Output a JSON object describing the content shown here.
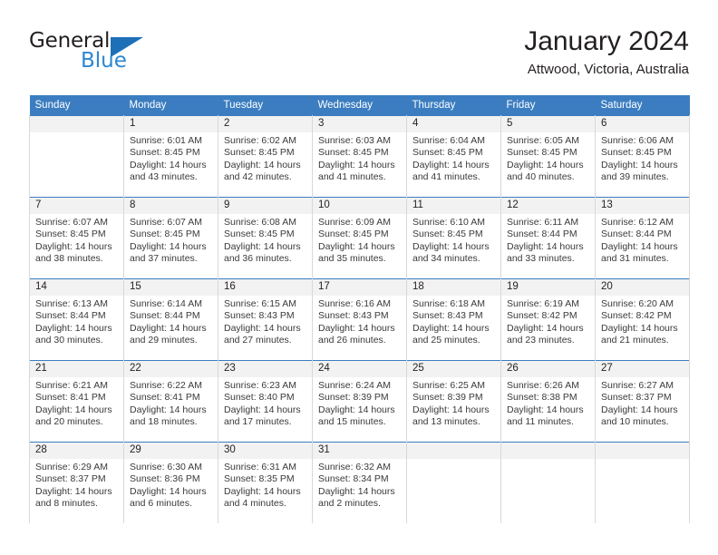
{
  "brand": {
    "name_part1": "General",
    "name_part2": "Blue",
    "triangle_color": "#1d70b8",
    "blue_color": "#2b87d3"
  },
  "header": {
    "title": "January 2024",
    "location": "Attwood, Victoria, Australia"
  },
  "theme": {
    "header_bar_color": "#3b7dc0",
    "daynum_band_color": "#f2f2f2",
    "cell_border_color": "#d8d8d8",
    "text_color": "#231f20"
  },
  "weekdays": [
    "Sunday",
    "Monday",
    "Tuesday",
    "Wednesday",
    "Thursday",
    "Friday",
    "Saturday"
  ],
  "weeks": [
    [
      {
        "day": "",
        "sunrise": "",
        "sunset": "",
        "daylight_line1": "",
        "daylight_line2": ""
      },
      {
        "day": "1",
        "sunrise": "Sunrise: 6:01 AM",
        "sunset": "Sunset: 8:45 PM",
        "daylight_line1": "Daylight: 14 hours",
        "daylight_line2": "and 43 minutes."
      },
      {
        "day": "2",
        "sunrise": "Sunrise: 6:02 AM",
        "sunset": "Sunset: 8:45 PM",
        "daylight_line1": "Daylight: 14 hours",
        "daylight_line2": "and 42 minutes."
      },
      {
        "day": "3",
        "sunrise": "Sunrise: 6:03 AM",
        "sunset": "Sunset: 8:45 PM",
        "daylight_line1": "Daylight: 14 hours",
        "daylight_line2": "and 41 minutes."
      },
      {
        "day": "4",
        "sunrise": "Sunrise: 6:04 AM",
        "sunset": "Sunset: 8:45 PM",
        "daylight_line1": "Daylight: 14 hours",
        "daylight_line2": "and 41 minutes."
      },
      {
        "day": "5",
        "sunrise": "Sunrise: 6:05 AM",
        "sunset": "Sunset: 8:45 PM",
        "daylight_line1": "Daylight: 14 hours",
        "daylight_line2": "and 40 minutes."
      },
      {
        "day": "6",
        "sunrise": "Sunrise: 6:06 AM",
        "sunset": "Sunset: 8:45 PM",
        "daylight_line1": "Daylight: 14 hours",
        "daylight_line2": "and 39 minutes."
      }
    ],
    [
      {
        "day": "7",
        "sunrise": "Sunrise: 6:07 AM",
        "sunset": "Sunset: 8:45 PM",
        "daylight_line1": "Daylight: 14 hours",
        "daylight_line2": "and 38 minutes."
      },
      {
        "day": "8",
        "sunrise": "Sunrise: 6:07 AM",
        "sunset": "Sunset: 8:45 PM",
        "daylight_line1": "Daylight: 14 hours",
        "daylight_line2": "and 37 minutes."
      },
      {
        "day": "9",
        "sunrise": "Sunrise: 6:08 AM",
        "sunset": "Sunset: 8:45 PM",
        "daylight_line1": "Daylight: 14 hours",
        "daylight_line2": "and 36 minutes."
      },
      {
        "day": "10",
        "sunrise": "Sunrise: 6:09 AM",
        "sunset": "Sunset: 8:45 PM",
        "daylight_line1": "Daylight: 14 hours",
        "daylight_line2": "and 35 minutes."
      },
      {
        "day": "11",
        "sunrise": "Sunrise: 6:10 AM",
        "sunset": "Sunset: 8:45 PM",
        "daylight_line1": "Daylight: 14 hours",
        "daylight_line2": "and 34 minutes."
      },
      {
        "day": "12",
        "sunrise": "Sunrise: 6:11 AM",
        "sunset": "Sunset: 8:44 PM",
        "daylight_line1": "Daylight: 14 hours",
        "daylight_line2": "and 33 minutes."
      },
      {
        "day": "13",
        "sunrise": "Sunrise: 6:12 AM",
        "sunset": "Sunset: 8:44 PM",
        "daylight_line1": "Daylight: 14 hours",
        "daylight_line2": "and 31 minutes."
      }
    ],
    [
      {
        "day": "14",
        "sunrise": "Sunrise: 6:13 AM",
        "sunset": "Sunset: 8:44 PM",
        "daylight_line1": "Daylight: 14 hours",
        "daylight_line2": "and 30 minutes."
      },
      {
        "day": "15",
        "sunrise": "Sunrise: 6:14 AM",
        "sunset": "Sunset: 8:44 PM",
        "daylight_line1": "Daylight: 14 hours",
        "daylight_line2": "and 29 minutes."
      },
      {
        "day": "16",
        "sunrise": "Sunrise: 6:15 AM",
        "sunset": "Sunset: 8:43 PM",
        "daylight_line1": "Daylight: 14 hours",
        "daylight_line2": "and 27 minutes."
      },
      {
        "day": "17",
        "sunrise": "Sunrise: 6:16 AM",
        "sunset": "Sunset: 8:43 PM",
        "daylight_line1": "Daylight: 14 hours",
        "daylight_line2": "and 26 minutes."
      },
      {
        "day": "18",
        "sunrise": "Sunrise: 6:18 AM",
        "sunset": "Sunset: 8:43 PM",
        "daylight_line1": "Daylight: 14 hours",
        "daylight_line2": "and 25 minutes."
      },
      {
        "day": "19",
        "sunrise": "Sunrise: 6:19 AM",
        "sunset": "Sunset: 8:42 PM",
        "daylight_line1": "Daylight: 14 hours",
        "daylight_line2": "and 23 minutes."
      },
      {
        "day": "20",
        "sunrise": "Sunrise: 6:20 AM",
        "sunset": "Sunset: 8:42 PM",
        "daylight_line1": "Daylight: 14 hours",
        "daylight_line2": "and 21 minutes."
      }
    ],
    [
      {
        "day": "21",
        "sunrise": "Sunrise: 6:21 AM",
        "sunset": "Sunset: 8:41 PM",
        "daylight_line1": "Daylight: 14 hours",
        "daylight_line2": "and 20 minutes."
      },
      {
        "day": "22",
        "sunrise": "Sunrise: 6:22 AM",
        "sunset": "Sunset: 8:41 PM",
        "daylight_line1": "Daylight: 14 hours",
        "daylight_line2": "and 18 minutes."
      },
      {
        "day": "23",
        "sunrise": "Sunrise: 6:23 AM",
        "sunset": "Sunset: 8:40 PM",
        "daylight_line1": "Daylight: 14 hours",
        "daylight_line2": "and 17 minutes."
      },
      {
        "day": "24",
        "sunrise": "Sunrise: 6:24 AM",
        "sunset": "Sunset: 8:39 PM",
        "daylight_line1": "Daylight: 14 hours",
        "daylight_line2": "and 15 minutes."
      },
      {
        "day": "25",
        "sunrise": "Sunrise: 6:25 AM",
        "sunset": "Sunset: 8:39 PM",
        "daylight_line1": "Daylight: 14 hours",
        "daylight_line2": "and 13 minutes."
      },
      {
        "day": "26",
        "sunrise": "Sunrise: 6:26 AM",
        "sunset": "Sunset: 8:38 PM",
        "daylight_line1": "Daylight: 14 hours",
        "daylight_line2": "and 11 minutes."
      },
      {
        "day": "27",
        "sunrise": "Sunrise: 6:27 AM",
        "sunset": "Sunset: 8:37 PM",
        "daylight_line1": "Daylight: 14 hours",
        "daylight_line2": "and 10 minutes."
      }
    ],
    [
      {
        "day": "28",
        "sunrise": "Sunrise: 6:29 AM",
        "sunset": "Sunset: 8:37 PM",
        "daylight_line1": "Daylight: 14 hours",
        "daylight_line2": "and 8 minutes."
      },
      {
        "day": "29",
        "sunrise": "Sunrise: 6:30 AM",
        "sunset": "Sunset: 8:36 PM",
        "daylight_line1": "Daylight: 14 hours",
        "daylight_line2": "and 6 minutes."
      },
      {
        "day": "30",
        "sunrise": "Sunrise: 6:31 AM",
        "sunset": "Sunset: 8:35 PM",
        "daylight_line1": "Daylight: 14 hours",
        "daylight_line2": "and 4 minutes."
      },
      {
        "day": "31",
        "sunrise": "Sunrise: 6:32 AM",
        "sunset": "Sunset: 8:34 PM",
        "daylight_line1": "Daylight: 14 hours",
        "daylight_line2": "and 2 minutes."
      },
      {
        "day": "",
        "sunrise": "",
        "sunset": "",
        "daylight_line1": "",
        "daylight_line2": ""
      },
      {
        "day": "",
        "sunrise": "",
        "sunset": "",
        "daylight_line1": "",
        "daylight_line2": ""
      },
      {
        "day": "",
        "sunrise": "",
        "sunset": "",
        "daylight_line1": "",
        "daylight_line2": ""
      }
    ]
  ]
}
